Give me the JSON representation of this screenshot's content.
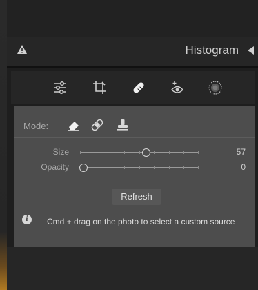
{
  "header": {
    "title": "Histogram",
    "warning_icon": "warning-icon",
    "collapse_icon": "triangle-left-icon"
  },
  "tools": [
    {
      "name": "edit-sliders-icon"
    },
    {
      "name": "crop-icon"
    },
    {
      "name": "healing-icon",
      "active": true
    },
    {
      "name": "red-eye-icon"
    },
    {
      "name": "masking-icon"
    }
  ],
  "heal": {
    "mode_label": "Mode:",
    "modes": [
      "content-aware-remove",
      "heal",
      "clone"
    ],
    "size_label": "Size",
    "size_value": "57",
    "opacity_label": "Opacity",
    "opacity_value": "0",
    "refresh_label": "Refresh",
    "info_text": "Cmd + drag on the photo to select a custom source"
  },
  "colors": {
    "panel": "#4d4d4d",
    "background": "#1e1e1e",
    "text": "#d6d6d6"
  }
}
